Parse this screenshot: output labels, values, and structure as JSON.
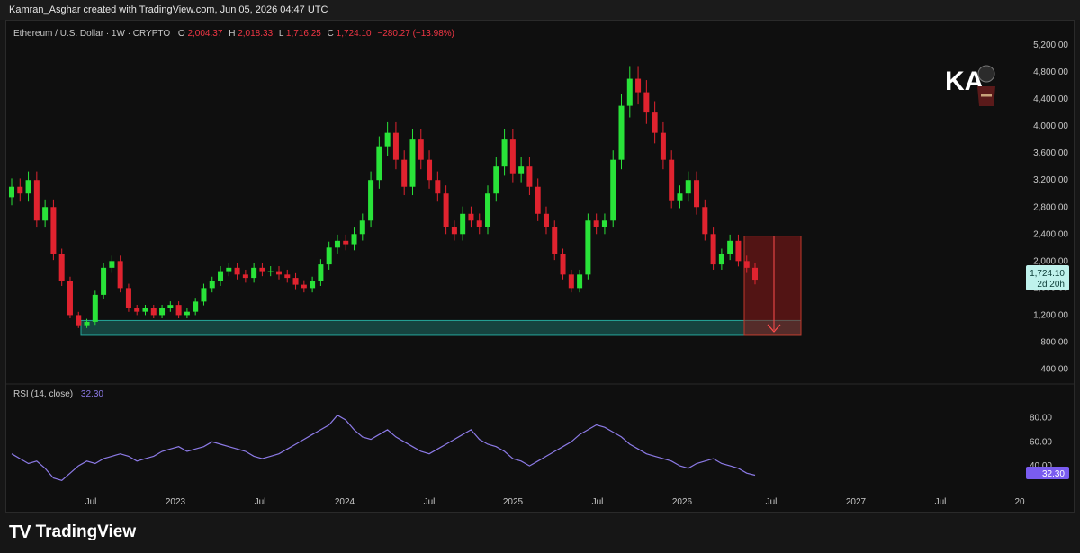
{
  "header": {
    "credit": "Kamran_Asghar created with TradingView.com, Jun 05, 2026 04:47 UTC"
  },
  "legend": {
    "symbol": "Ethereum / U.S. Dollar · 1W · CRYPTO",
    "o_label": "O",
    "o_value": "2,004.37",
    "h_label": "H",
    "h_value": "2,018.33",
    "l_label": "L",
    "l_value": "1,716.25",
    "c_label": "C",
    "c_value": "1,724.10",
    "change": "−280.27 (−13.98%)"
  },
  "price_badge": {
    "price": "1,724.10",
    "countdown": "2d 20h"
  },
  "rsi_legend": {
    "label": "RSI (14, close)",
    "value": "32.30"
  },
  "rsi_badge": "32.30",
  "footer": {
    "logo": "TV",
    "brand": "TradingView"
  },
  "watermark": {
    "text": "KA"
  },
  "colors": {
    "up": "#29e339",
    "down": "#e0232f",
    "rsi": "#8c7ae6",
    "support": "#26a69a",
    "target": "#8b1a1a"
  },
  "chart_data": [
    {
      "type": "candlestick",
      "title": "Ethereum / U.S. Dollar · 1W · CRYPTO",
      "y_ticks": [
        "5,200.00",
        "4,800.00",
        "4,400.00",
        "4,000.00",
        "3,600.00",
        "3,200.00",
        "2,800.00",
        "2,400.00",
        "2,000.00",
        "1,600.00",
        "1,200.00",
        "800.00",
        "400.00"
      ],
      "x_ticks": [
        "Jul",
        "2023",
        "Jul",
        "2024",
        "Jul",
        "2025",
        "Jul",
        "2026",
        "Jul",
        "2027",
        "Jul",
        "20"
      ],
      "ylim": [
        300,
        5400
      ],
      "approx_weekly_closes": [
        3100,
        3000,
        3200,
        2600,
        2800,
        2100,
        1700,
        1200,
        1050,
        1100,
        1500,
        1900,
        2000,
        1600,
        1300,
        1250,
        1300,
        1200,
        1300,
        1350,
        1200,
        1250,
        1400,
        1600,
        1700,
        1850,
        1900,
        1800,
        1750,
        1900,
        1850,
        1850,
        1800,
        1750,
        1650,
        1600,
        1700,
        1950,
        2200,
        2300,
        2250,
        2400,
        2600,
        3200,
        3700,
        3900,
        3500,
        3100,
        3800,
        3500,
        3200,
        3000,
        2500,
        2400,
        2700,
        2600,
        2500,
        3000,
        3400,
        3800,
        3300,
        3400,
        3100,
        2700,
        2500,
        2100,
        1800,
        1600,
        1800,
        2600,
        2500,
        2600,
        3500,
        4300,
        4700,
        4500,
        4200,
        3900,
        3500,
        2900,
        3000,
        3200,
        2800,
        2400,
        1950,
        2100,
        2300,
        2000,
        1900,
        1724
      ],
      "annotations": {
        "support_zone": [
          900,
          1120
        ],
        "projection_box": [
          900,
          2370
        ]
      }
    },
    {
      "type": "line",
      "title": "RSI (14, close)",
      "y_ticks": [
        "80.00",
        "60.00",
        "40.00"
      ],
      "ylim": [
        20,
        90
      ],
      "last_value": 32.3,
      "approx_values": [
        50,
        46,
        42,
        44,
        38,
        30,
        28,
        34,
        40,
        44,
        42,
        46,
        48,
        50,
        48,
        44,
        46,
        48,
        52,
        54,
        56,
        52,
        54,
        56,
        60,
        58,
        56,
        54,
        52,
        48,
        46,
        48,
        50,
        54,
        58,
        62,
        66,
        70,
        74,
        82,
        78,
        70,
        64,
        62,
        66,
        70,
        64,
        60,
        56,
        52,
        50,
        54,
        58,
        62,
        66,
        70,
        62,
        58,
        56,
        52,
        46,
        44,
        40,
        44,
        48,
        52,
        56,
        60,
        66,
        70,
        74,
        72,
        68,
        64,
        58,
        54,
        50,
        48,
        46,
        44,
        40,
        38,
        42,
        44,
        46,
        42,
        40,
        38,
        34,
        32.3
      ]
    }
  ]
}
